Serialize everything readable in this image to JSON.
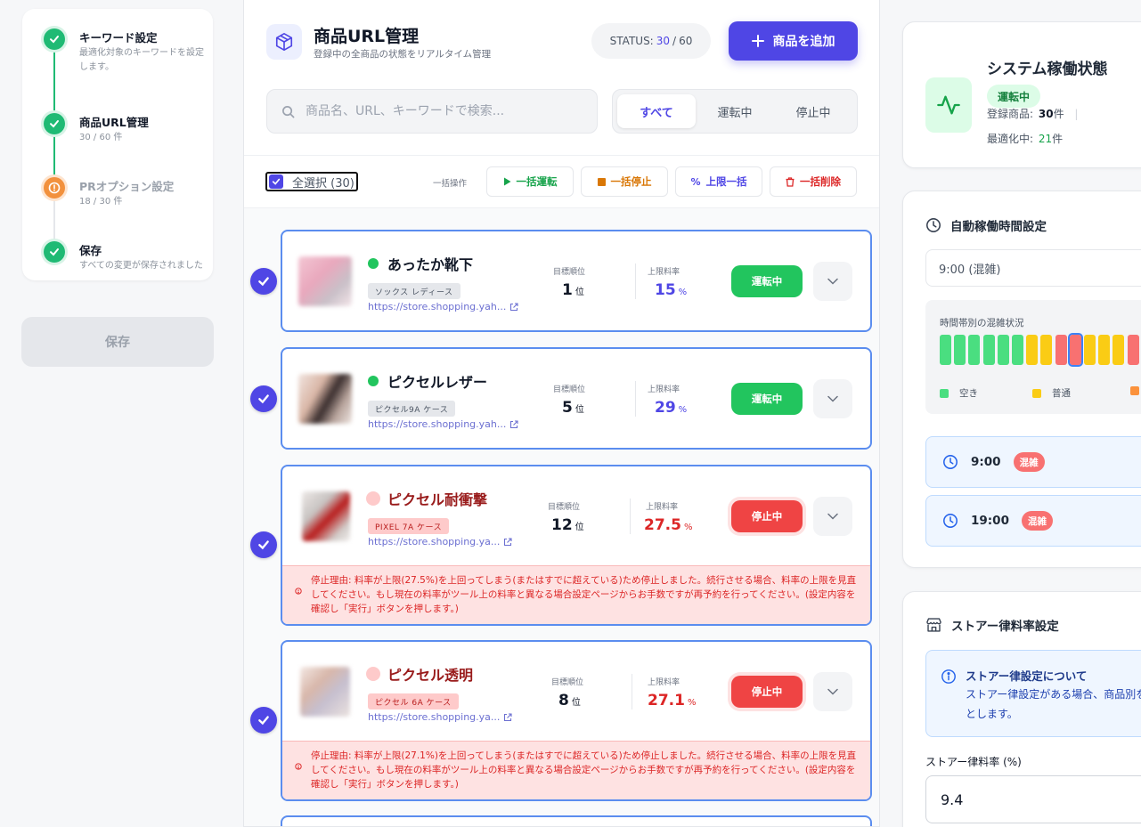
{
  "steps": [
    {
      "title": "キーワード設定",
      "sub": "最適化対象のキーワードを設定します。",
      "state": "done"
    },
    {
      "title": "商品URL管理",
      "sub": "30 / 60 件",
      "state": "done"
    },
    {
      "title": "PRオプション設定",
      "sub": "18 / 30 件",
      "state": "warn"
    },
    {
      "title": "保存",
      "sub": "すべての変更が保存されました",
      "state": "done"
    }
  ],
  "save_button": "保存",
  "header": {
    "title": "商品URL管理",
    "subtitle": "登録中の全商品の状態をリアルタイム管理",
    "status_label": "STATUS:",
    "status_current": "30",
    "status_sep": "/",
    "status_total": "60",
    "add_button": "商品を追加"
  },
  "search": {
    "placeholder": "商品名、URL、キーワードで検索..."
  },
  "filters": [
    "すべて",
    "運転中",
    "停止中"
  ],
  "bulk": {
    "select_all": "全選択 (30)",
    "label": "一括操作",
    "run": "一括運転",
    "stop": "一括停止",
    "limit": "上限一括",
    "delete": "一括削除"
  },
  "metric_labels": {
    "rank": "目標順位",
    "rate": "上限料率",
    "rank_unit": "位",
    "rate_unit": "%"
  },
  "products": [
    {
      "name": "あったか靴下",
      "tag": "ソックス レディース",
      "url": "https://store.shopping.yah...",
      "rank": "1",
      "rate": "15",
      "state": "運転中",
      "running": true
    },
    {
      "name": "ピクセルレザー",
      "tag": "ピクセル9A ケース",
      "url": "https://store.shopping.yah...",
      "rank": "5",
      "rate": "29",
      "state": "運転中",
      "running": true
    },
    {
      "name": "ピクセル耐衝撃",
      "tag": "PIXEL 7A ケース",
      "url": "https://store.shopping.ya...",
      "rank": "12",
      "rate": "27.5",
      "state": "停止中",
      "running": false,
      "error": "停止理由: 料率が上限(27.5%)を上回ってしまう(またはすでに超えている)ため停止しました。続行させる場合、料率の上限を見直してください。もし現在の料率がツール上の料率と異なる場合設定ページからお手数ですが再予約を行ってください。(設定内容を確認し「実行」ボタンを押します。)"
    },
    {
      "name": "ピクセル透明",
      "tag": "ピクセル 6A ケース",
      "url": "https://store.shopping.ya...",
      "rank": "8",
      "rate": "27.1",
      "state": "停止中",
      "running": false,
      "error": "停止理由: 料率が上限(27.1%)を上回ってしまう(またはすでに超えている)ため停止しました。続行させる場合、料率の上限を見直してください。もし現在の料率がツール上の料率と異なる場合設定ページからお手数ですが再予約を行ってください。(設定内容を確認し「実行」ボタンを押します。)"
    }
  ],
  "system": {
    "title": "システム稼働状態",
    "badge": "運転中",
    "registered_label": "登録商品:",
    "registered": "30",
    "registered_unit": "件",
    "optimizing_label": "最適化中:",
    "optimizing": "21",
    "optimizing_unit": "件"
  },
  "schedule": {
    "title": "自動稼働時間設定",
    "selected": "9:00 (混雑)",
    "heat_title": "時間帯別の混雑状況",
    "heat_levels": [
      "free",
      "free",
      "free",
      "free",
      "free",
      "free",
      "normal",
      "normal",
      "busy",
      "busy",
      "normal",
      "normal",
      "normal",
      "busy"
    ],
    "selected_index": 9,
    "legend": [
      "空き",
      "普通"
    ],
    "colors": {
      "free": "#4ade80",
      "normal": "#facc15",
      "busy": "#f87171",
      "orange": "#fb923c"
    },
    "slots": [
      {
        "time": "9:00",
        "badge": "混雑"
      },
      {
        "time": "19:00",
        "badge": "混雑"
      }
    ]
  },
  "store": {
    "title": "ストアー律料率設定",
    "info_title": "ストアー律設定について",
    "info_text": "ストアー律設定がある場合、商品別を無効とします。",
    "rate_label": "ストアー律料率 (%)",
    "rate_value": "9.4"
  }
}
